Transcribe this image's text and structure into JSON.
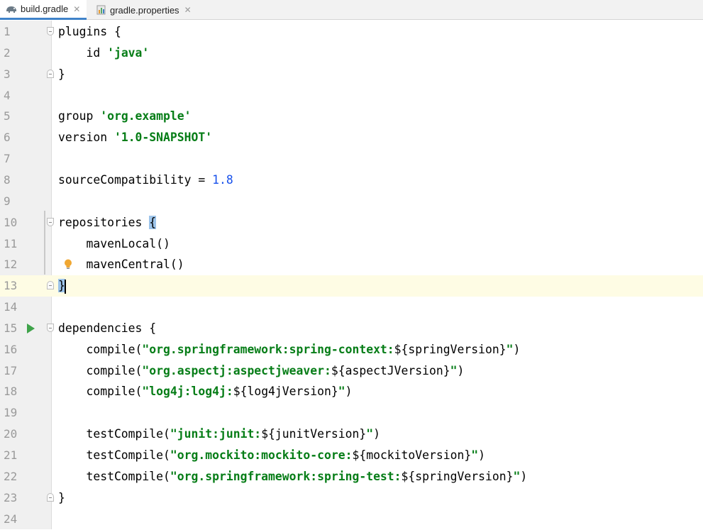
{
  "tabs": [
    {
      "label": "build.gradle",
      "icon": "gradle-elephant-icon",
      "active": true
    },
    {
      "label": "gradle.properties",
      "icon": "properties-file-icon",
      "active": false
    }
  ],
  "colors": {
    "string": "#067d17",
    "number": "#1750eb",
    "current_line": "#fefce4",
    "bracket_highlight": "#9dc4ea",
    "tab_underline": "#4083c9"
  },
  "current_line": 13,
  "lines": [
    {
      "n": "1",
      "segments": [
        {
          "t": "plugins {",
          "c": "plain"
        }
      ]
    },
    {
      "n": "2",
      "segments": [
        {
          "t": "    id ",
          "c": "plain"
        },
        {
          "t": "'java'",
          "c": "str"
        }
      ]
    },
    {
      "n": "3",
      "segments": [
        {
          "t": "}",
          "c": "plain"
        }
      ]
    },
    {
      "n": "4",
      "segments": []
    },
    {
      "n": "5",
      "segments": [
        {
          "t": "group ",
          "c": "plain"
        },
        {
          "t": "'org.example'",
          "c": "str"
        }
      ]
    },
    {
      "n": "6",
      "segments": [
        {
          "t": "version ",
          "c": "plain"
        },
        {
          "t": "'1.0-SNAPSHOT'",
          "c": "str"
        }
      ]
    },
    {
      "n": "7",
      "segments": []
    },
    {
      "n": "8",
      "segments": [
        {
          "t": "sourceCompatibility = ",
          "c": "plain"
        },
        {
          "t": "1.8",
          "c": "num"
        }
      ]
    },
    {
      "n": "9",
      "segments": []
    },
    {
      "n": "10",
      "segments": [
        {
          "t": "repositories ",
          "c": "plain"
        },
        {
          "t": "{",
          "c": "brace-hl"
        }
      ]
    },
    {
      "n": "11",
      "segments": [
        {
          "t": "    mavenLocal()",
          "c": "plain"
        }
      ]
    },
    {
      "n": "12",
      "segments": [
        {
          "t": "    mavenCentral()",
          "c": "plain"
        }
      ]
    },
    {
      "n": "13",
      "segments": [
        {
          "t": "}",
          "c": "brace-hl-caret"
        }
      ]
    },
    {
      "n": "14",
      "segments": []
    },
    {
      "n": "15",
      "segments": [
        {
          "t": "dependencies {",
          "c": "plain"
        }
      ]
    },
    {
      "n": "16",
      "segments": [
        {
          "t": "    compile(",
          "c": "plain"
        },
        {
          "t": "\"org.springframework:spring-context:",
          "c": "str"
        },
        {
          "t": "${springVersion}",
          "c": "plain"
        },
        {
          "t": "\"",
          "c": "str"
        },
        {
          "t": ")",
          "c": "plain"
        }
      ]
    },
    {
      "n": "17",
      "segments": [
        {
          "t": "    compile(",
          "c": "plain"
        },
        {
          "t": "\"org.aspectj:aspectjweaver:",
          "c": "str"
        },
        {
          "t": "${aspectJVersion}",
          "c": "plain"
        },
        {
          "t": "\"",
          "c": "str"
        },
        {
          "t": ")",
          "c": "plain"
        }
      ]
    },
    {
      "n": "18",
      "segments": [
        {
          "t": "    compile(",
          "c": "plain"
        },
        {
          "t": "\"log4j:log4j:",
          "c": "str"
        },
        {
          "t": "${log4jVersion}",
          "c": "plain"
        },
        {
          "t": "\"",
          "c": "str"
        },
        {
          "t": ")",
          "c": "plain"
        }
      ]
    },
    {
      "n": "19",
      "segments": []
    },
    {
      "n": "20",
      "segments": [
        {
          "t": "    testCompile(",
          "c": "plain"
        },
        {
          "t": "\"junit:junit:",
          "c": "str"
        },
        {
          "t": "${junitVersion}",
          "c": "plain"
        },
        {
          "t": "\"",
          "c": "str"
        },
        {
          "t": ")",
          "c": "plain"
        }
      ]
    },
    {
      "n": "21",
      "segments": [
        {
          "t": "    testCompile(",
          "c": "plain"
        },
        {
          "t": "\"org.mockito:mockito-core:",
          "c": "str"
        },
        {
          "t": "${mockitoVersion}",
          "c": "plain"
        },
        {
          "t": "\"",
          "c": "str"
        },
        {
          "t": ")",
          "c": "plain"
        }
      ]
    },
    {
      "n": "22",
      "segments": [
        {
          "t": "    testCompile(",
          "c": "plain"
        },
        {
          "t": "\"org.springframework:spring-test:",
          "c": "str"
        },
        {
          "t": "${springVersion}",
          "c": "plain"
        },
        {
          "t": "\"",
          "c": "str"
        },
        {
          "t": ")",
          "c": "plain"
        }
      ]
    },
    {
      "n": "23",
      "segments": [
        {
          "t": "}",
          "c": "plain"
        }
      ]
    },
    {
      "n": "24",
      "segments": []
    }
  ],
  "gutter_marks": [
    {
      "line": "1",
      "icon": "fold-open-icon"
    },
    {
      "line": "3",
      "icon": "fold-close-icon"
    },
    {
      "line": "10",
      "icon": "fold-open-icon"
    },
    {
      "line": "12",
      "icon": "lightbulb-icon"
    },
    {
      "line": "13",
      "icon": "fold-close-icon"
    },
    {
      "line": "15",
      "icon": "run-icon"
    },
    {
      "line": "15",
      "icon": "fold-open-icon"
    },
    {
      "line": "23",
      "icon": "fold-close-icon"
    }
  ]
}
